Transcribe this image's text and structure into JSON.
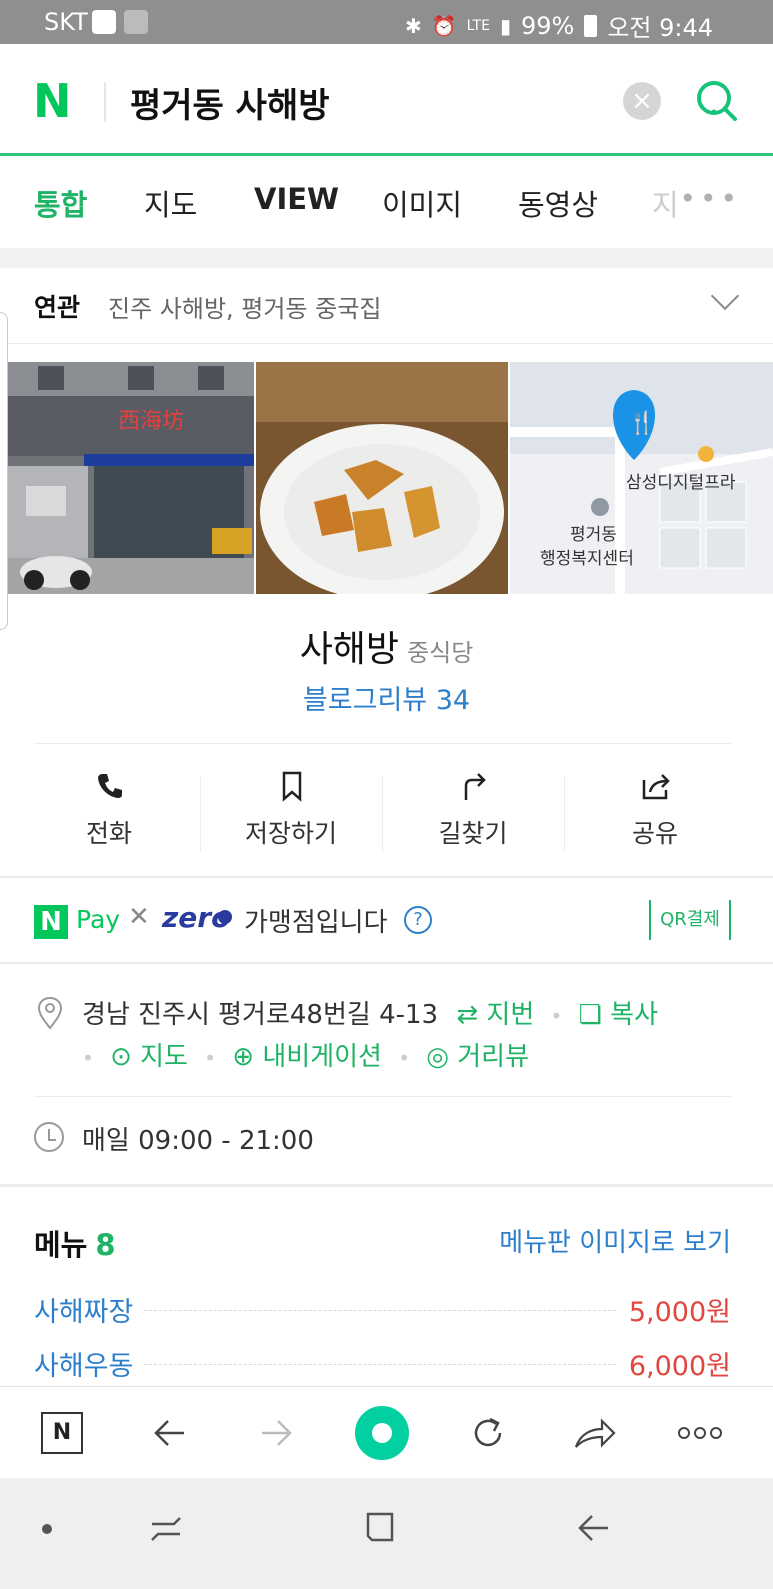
{
  "status_bar": {
    "carrier": "SKT",
    "signal": "LTE",
    "battery": "99%",
    "time": "오전 9:44"
  },
  "search": {
    "logo": "N",
    "query": "평거동 사해방"
  },
  "tabs": [
    {
      "label": "통합"
    },
    {
      "label": "지도"
    },
    {
      "label": "VIEW"
    },
    {
      "label": "이미지"
    },
    {
      "label": "동영상"
    },
    {
      "label": "지"
    }
  ],
  "related": {
    "label": "연관",
    "text": "진주 사해방, 평거동 중국집"
  },
  "photos": {
    "sign_text": "西海坊",
    "map_label_1": "삼성디지털프라",
    "map_label_2_line1": "평거동",
    "map_label_2_line2": "행정복지센터"
  },
  "place": {
    "name": "사해방",
    "category": "중식당",
    "blog_review": "블로그리뷰 34"
  },
  "actions": [
    {
      "label": "전화",
      "icon": "phone-icon"
    },
    {
      "label": "저장하기",
      "icon": "bookmark-icon"
    },
    {
      "label": "길찾기",
      "icon": "directions-icon"
    },
    {
      "label": "공유",
      "icon": "share-icon"
    }
  ],
  "pay": {
    "n": "N",
    "pay": "Pay",
    "zero": "zero",
    "zero_badge": "Pay",
    "merchant_text": "가맹점입니다",
    "qr": "QR결제"
  },
  "address": {
    "text": "경남 진주시 평거로48번길 4-13",
    "jibun": "지번",
    "copy": "복사",
    "map": "지도",
    "navigation": "내비게이션",
    "street_view": "거리뷰"
  },
  "hours": {
    "text": "매일 09:00 - 21:00"
  },
  "menu": {
    "title": "메뉴",
    "count": "8",
    "view_image": "메뉴판 이미지로 보기",
    "items": [
      {
        "name": "사해짜장",
        "price": "5,000원"
      },
      {
        "name": "사해우동",
        "price": "6,000원"
      }
    ]
  },
  "toolbar": {
    "home": "N"
  },
  "colors": {
    "naver_green": "#03c75a",
    "link_blue": "#2d7fcb",
    "price_red": "#e2473f"
  }
}
